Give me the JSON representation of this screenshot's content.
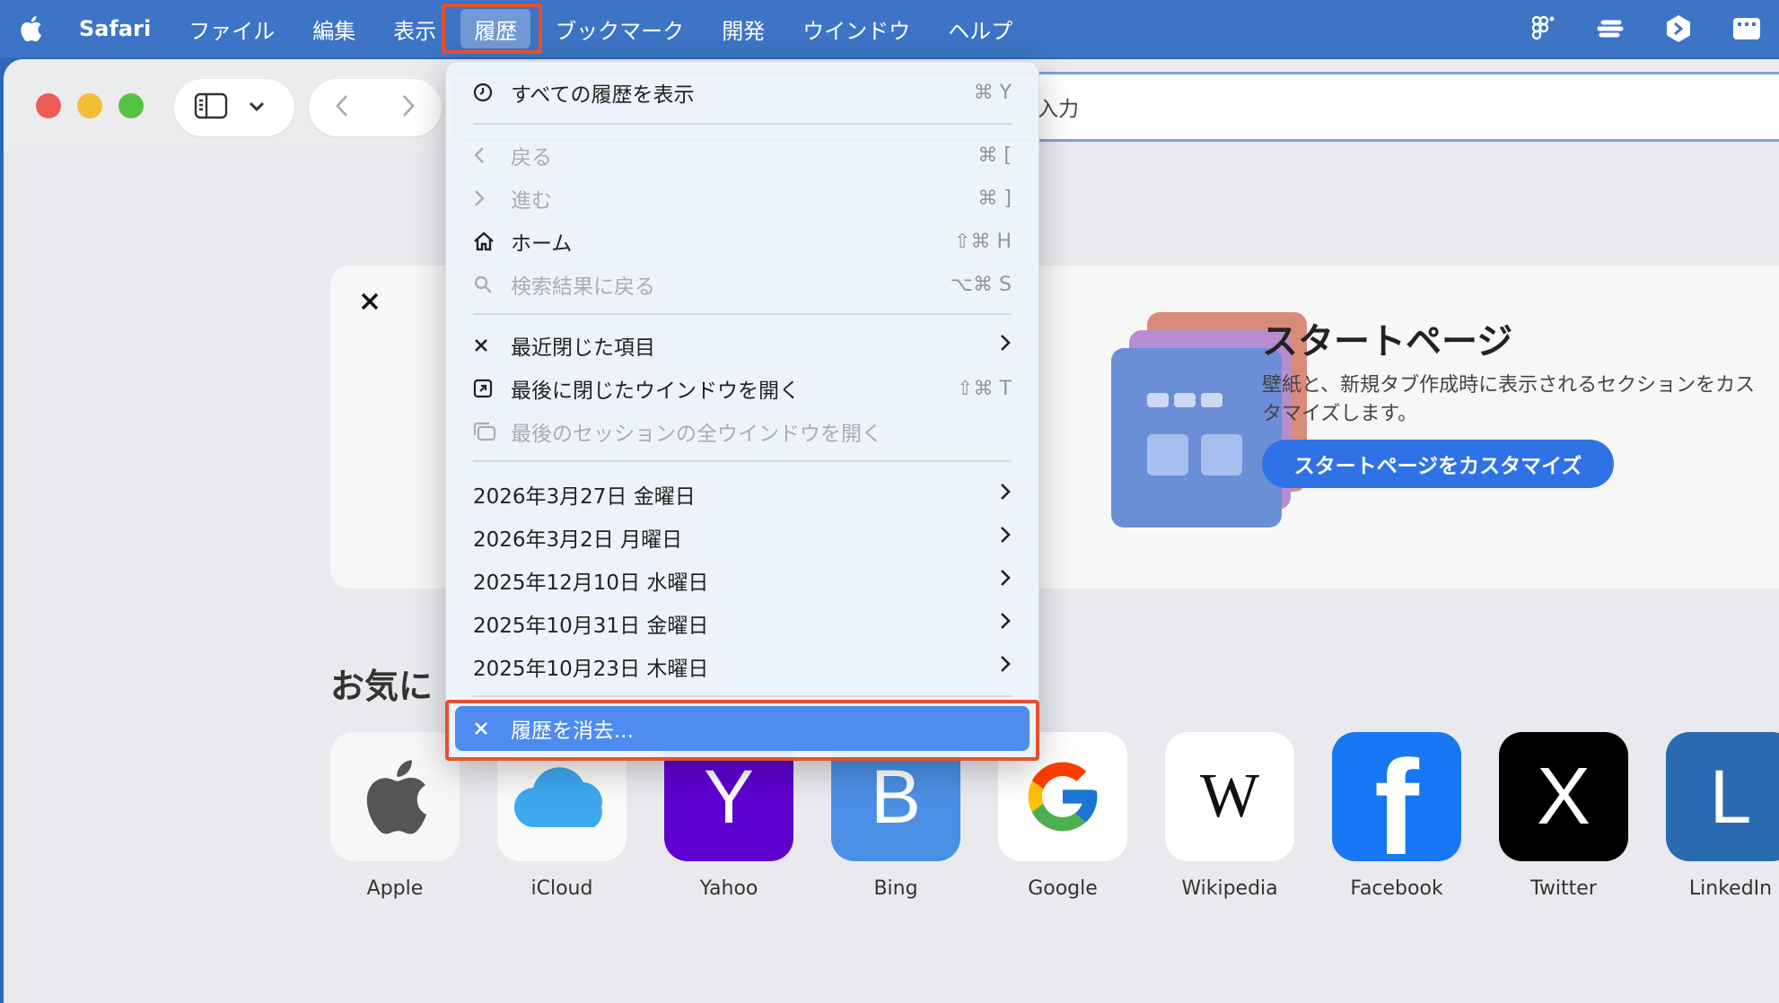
{
  "menubar": {
    "app": "Safari",
    "items": [
      "ファイル",
      "編集",
      "表示",
      "履歴",
      "ブックマーク",
      "開発",
      "ウインドウ",
      "ヘルプ"
    ]
  },
  "address_placeholder": "入力",
  "history_menu": {
    "show_all": {
      "label": "すべての履歴を表示",
      "shortcut": "⌘ Y"
    },
    "back": {
      "label": "戻る",
      "shortcut": "⌘ ["
    },
    "forward": {
      "label": "進む",
      "shortcut": "⌘ ]"
    },
    "home": {
      "label": "ホーム",
      "shortcut": "⇧⌘ H"
    },
    "search_back": {
      "label": "検索結果に戻る",
      "shortcut": "⌥⌘ S"
    },
    "recently_closed": {
      "label": "最近閉じた項目"
    },
    "reopen_window": {
      "label": "最後に閉じたウインドウを開く",
      "shortcut": "⇧⌘ T"
    },
    "reopen_session": {
      "label": "最後のセッションの全ウインドウを開く"
    },
    "dates": [
      "2026年3月27日 金曜日",
      "2026年3月2日 月曜日",
      "2025年12月10日 水曜日",
      "2025年10月31日 金曜日",
      "2025年10月23日 木曜日"
    ],
    "clear": {
      "label": "履歴を消去..."
    }
  },
  "start_card": {
    "title": "スタートページ",
    "description": "壁紙と、新規タブ作成時に表示されるセクションをカスタマイズします。",
    "button": "スタートページをカスタマイズ"
  },
  "favorites": {
    "title": "お気に",
    "items": [
      {
        "label": "Apple",
        "icon": "apple-icon"
      },
      {
        "label": "iCloud",
        "icon": "icloud-icon"
      },
      {
        "label": "Yahoo",
        "icon": "yahoo-icon",
        "glyph": "Y",
        "color": "#5f01d1"
      },
      {
        "label": "Bing",
        "icon": "bing-icon",
        "glyph": "B",
        "color": "#4b8fe5"
      },
      {
        "label": "Google",
        "icon": "google-icon"
      },
      {
        "label": "Wikipedia",
        "icon": "wikipedia-icon",
        "glyph": "W"
      },
      {
        "label": "Facebook",
        "icon": "facebook-icon",
        "glyph": "f",
        "color": "#1877f2"
      },
      {
        "label": "Twitter",
        "icon": "x-icon",
        "glyph": "X",
        "color": "#000000"
      },
      {
        "label": "LinkedIn",
        "icon": "linkedin-icon",
        "glyph": "L",
        "color": "#2a6ab0"
      }
    ]
  }
}
